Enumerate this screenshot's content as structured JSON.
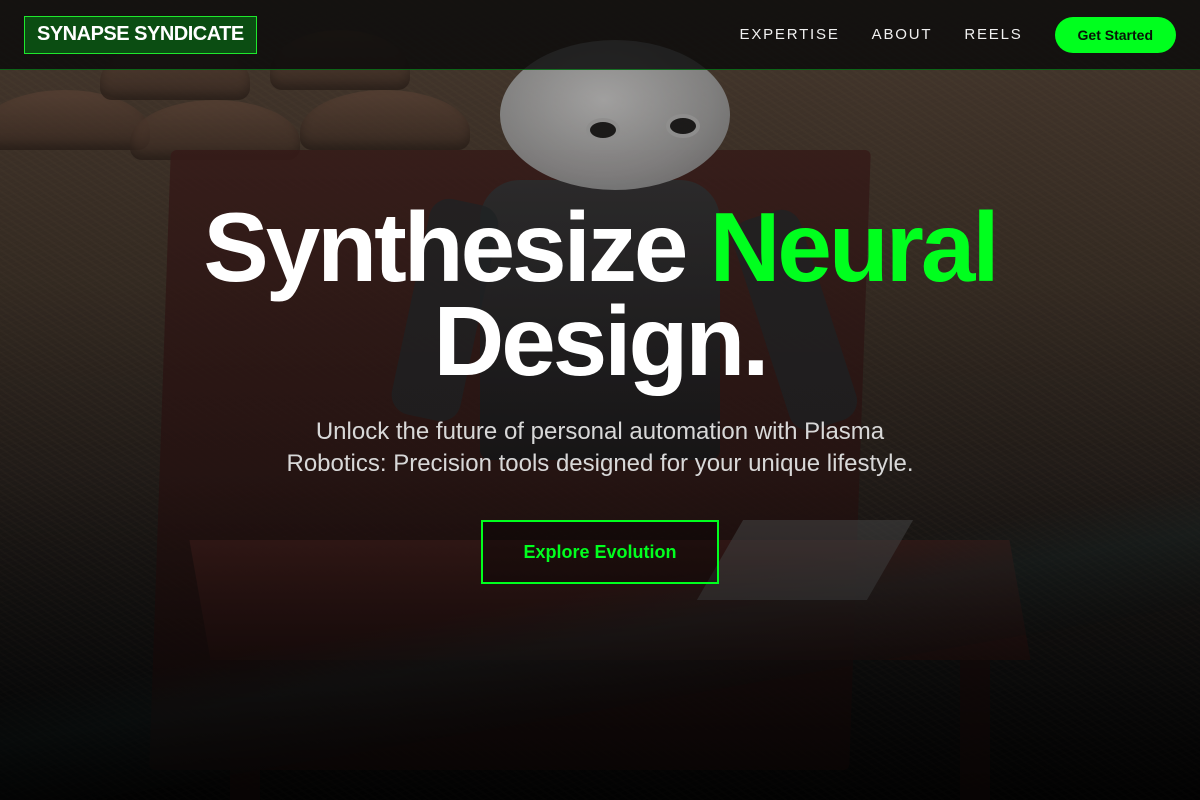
{
  "nav": {
    "logo": "SYNAPSE SYNDICATE",
    "links": [
      "EXPERTISE",
      "ABOUT",
      "REELS"
    ],
    "cta_label": "Get Started"
  },
  "hero": {
    "headline_part1": "Synthesize",
    "headline_accent": "Neural",
    "headline_part2": "Design.",
    "subtitle": "Unlock the future of personal automation with Plasma Robotics: Precision tools designed for your unique lifestyle.",
    "cta_label": "Explore Evolution"
  },
  "colors": {
    "accent": "#00ff1e",
    "nav_bg": "#0a0a0a",
    "logo_bg": "#0b4d12"
  }
}
